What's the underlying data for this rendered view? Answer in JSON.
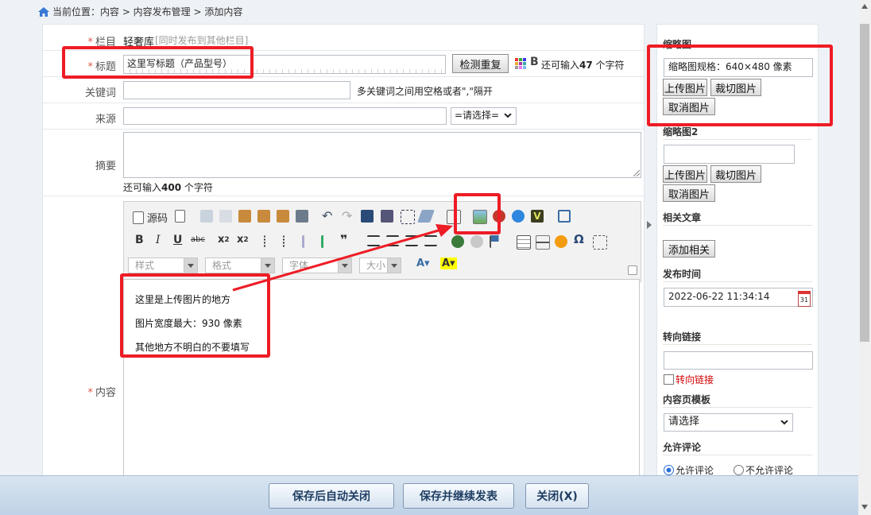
{
  "breadcrumb": {
    "text": "当前位置：内容 > 内容发布管理 > 添加内容"
  },
  "form": {
    "column_label": "栏目",
    "column_value": "轻奢库",
    "column_extra": "[同时发布到其他栏目]",
    "title_label": "标题",
    "title_value": "这里写标题（产品型号）",
    "check_dup_button": "检测重复",
    "bold_icon": "B",
    "title_remaining": "还可输入",
    "title_remaining_count": "47",
    "title_remaining_unit": "个字符",
    "keywords_label": "关键词",
    "keywords_value": "",
    "keywords_hint": "多关键词之间用空格或者\",\"隔开",
    "source_label": "来源",
    "source_value": "",
    "source_select": "=请选择=",
    "summary_label": "摘要",
    "summary_value": "",
    "summary_remaining": "还可输入",
    "summary_remaining_count": "400",
    "summary_remaining_unit": "个字符",
    "content_label": "内容"
  },
  "editor": {
    "source_button": "源码",
    "style_combo": "样式",
    "format_combo": "格式",
    "font_combo": "字体",
    "size_combo": "大小",
    "lines": [
      "这里是上传图片的地方",
      "图片宽度最大：930 像素",
      "其他地方不明白的不要填写"
    ]
  },
  "sidebar": {
    "thumb_title": "缩略图",
    "thumb_value": "缩略图规格：640×480 像素",
    "upload_button": "上传图片",
    "crop_button": "裁切图片",
    "cancel_button": "取消图片",
    "thumb2_title": "缩略图2",
    "thumb2_value": "",
    "upload2_button": "上传图片",
    "crop2_button": "裁切图片",
    "cancel2_button": "取消图片",
    "related_title": "相关文章",
    "add_related_button": "添加相关",
    "publish_time_title": "发布时间",
    "publish_time_value": "2022-06-22 11:34:14",
    "calendar_day": "31",
    "redirect_title": "转向链接",
    "redirect_value": "",
    "redirect_checkbox": "转向链接",
    "template_title": "内容页模板",
    "template_select": "请选择",
    "comment_title": "允许评论",
    "comment_allow": "允许评论",
    "comment_deny": "不允许评论"
  },
  "actions": {
    "save_close": "保存后自动关闭",
    "save_continue": "保存并继续发表",
    "close": "关闭(X)"
  },
  "colors": {
    "required": "#e05a47",
    "annotation": "#ee1c25",
    "link_red": "#d40000"
  }
}
